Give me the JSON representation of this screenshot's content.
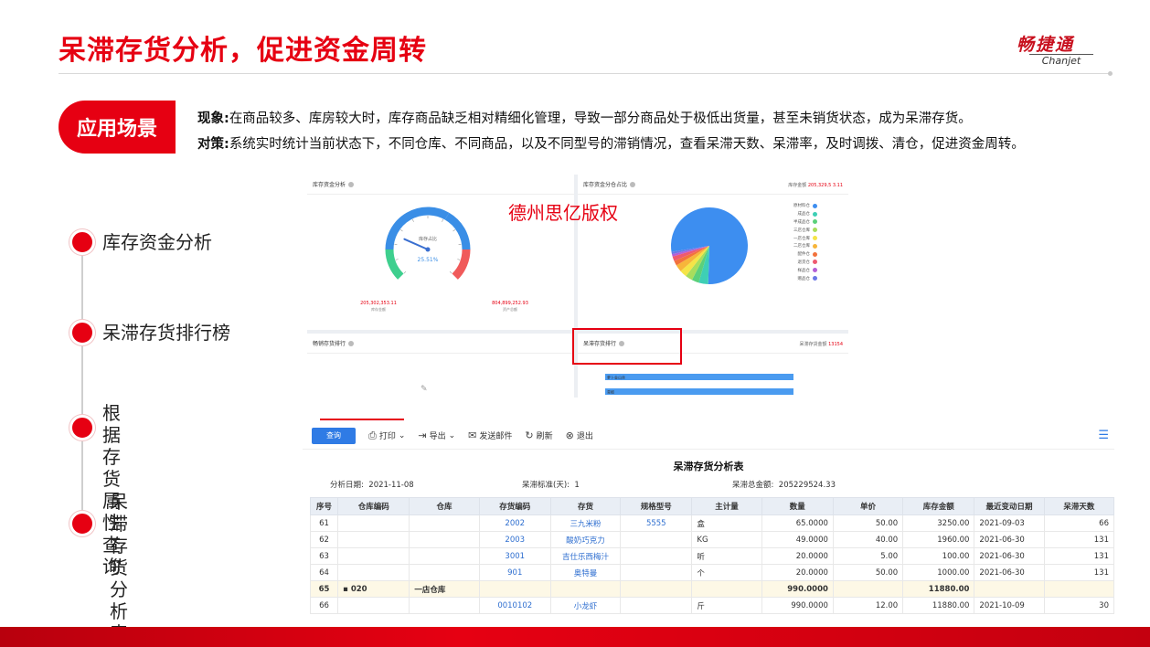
{
  "header": {
    "title": "呆滞存货分析，促进资金周转"
  },
  "logo": {
    "cn": "畅捷通",
    "en": "Chanjet"
  },
  "scene": {
    "tag": "应用场景",
    "phenomenon_label": "现象:",
    "phenomenon_text": "在商品较多、库房较大时，库存商品缺乏相对精细化管理，导致一部分商品处于极低出货量，甚至未销货状态，成为呆滞存货。",
    "strategy_label": "对策:",
    "strategy_text": "系统实时统计当前状态下，不同仓库、不同商品，以及不同型号的滞销情况，查看呆滞天数、呆滞率，及时调拨、清仓，促进资金周转。"
  },
  "timeline": [
    {
      "label": "库存资金分析"
    },
    {
      "label": "呆滞存货排行榜"
    },
    {
      "label": "根据存货属性\n查询"
    },
    {
      "label": "呆滞存货\n分析表"
    }
  ],
  "dashboard": {
    "watermark": "德州思亿版权",
    "panels": {
      "capital": {
        "title": "库存资金分析"
      },
      "share": {
        "title": "库存资金分仓占比",
        "tag_label": "库存金额",
        "tag_value": "205,329,5 3.11"
      },
      "sales": {
        "title": "畅销存货排行"
      },
      "stale": {
        "title": "呆滞存货排行",
        "tag_label": "呆滞存货金额",
        "tag_value": "13154"
      }
    },
    "gauge": {
      "center_label": "库存占比",
      "percent": "25.51%",
      "left_value": "205,302,353.11",
      "left_label": "库存金额",
      "right_value": "804,899,252.93",
      "right_label": "资产总额",
      "fraction": 0.2551
    },
    "pie": {
      "slices": [
        {
          "color": "#3d8ef0",
          "value": 78
        },
        {
          "color": "#3ecfb5",
          "value": 4
        },
        {
          "color": "#5bd07a",
          "value": 3
        },
        {
          "color": "#a8dd5c",
          "value": 3
        },
        {
          "color": "#f5e447",
          "value": 3
        },
        {
          "color": "#f7b53a",
          "value": 3
        },
        {
          "color": "#f2723c",
          "value": 2
        },
        {
          "color": "#ee5a6f",
          "value": 2
        },
        {
          "color": "#b45fd6",
          "value": 1
        },
        {
          "color": "#6a78e6",
          "value": 1
        }
      ],
      "legend": [
        "原材料仓",
        "成品仓",
        "半成品仓",
        "三店仓库",
        "一店仓库",
        "二店仓库",
        "配件仓",
        "退货仓",
        "样品仓",
        "赠品仓"
      ],
      "legend_colors": [
        "#3d8ef0",
        "#3ecfb5",
        "#5bd07a",
        "#a8dd5c",
        "#f5e447",
        "#f7b53a",
        "#f2723c",
        "#ee5a6f",
        "#b45fd6",
        "#6a78e6"
      ]
    },
    "stale_bars": [
      {
        "label": "萝卜金山丝",
        "fraction": 1.0
      },
      {
        "label": "青椒",
        "fraction": 1.0
      }
    ]
  },
  "report": {
    "toolbar": {
      "query": "查询",
      "print": "打印",
      "export": "导出",
      "mail": "发送邮件",
      "refresh": "刷新",
      "exit": "退出"
    },
    "title": "呆滞存货分析表",
    "meta": {
      "date_label": "分析日期:",
      "date_value": "2021-11-08",
      "std_label": "呆滞标准(天):",
      "std_value": "1",
      "total_label": "呆滞总金额:",
      "total_value": "205229524.33"
    },
    "columns": [
      "序号",
      "仓库编码",
      "仓库",
      "存货编码",
      "存货",
      "规格型号",
      "主计量",
      "数量",
      "单价",
      "库存金额",
      "最近变动日期",
      "呆滞天数"
    ],
    "rows": [
      {
        "no": "61",
        "wh_code": "",
        "wh": "",
        "code": "2002",
        "name": "三九米粉",
        "spec": "5555",
        "unit": "盒",
        "qty": "65.0000",
        "price": "50.00",
        "amount": "3250.00",
        "date": "2021-09-03",
        "days": "66",
        "sub": false
      },
      {
        "no": "62",
        "wh_code": "",
        "wh": "",
        "code": "2003",
        "name": "酸奶巧克力",
        "spec": "",
        "unit": "KG",
        "qty": "49.0000",
        "price": "40.00",
        "amount": "1960.00",
        "date": "2021-06-30",
        "days": "131",
        "sub": false
      },
      {
        "no": "63",
        "wh_code": "",
        "wh": "",
        "code": "3001",
        "name": "吉仕乐西梅汁",
        "spec": "",
        "unit": "听",
        "qty": "20.0000",
        "price": "5.00",
        "amount": "100.00",
        "date": "2021-06-30",
        "days": "131",
        "sub": false
      },
      {
        "no": "64",
        "wh_code": "",
        "wh": "",
        "code": "901",
        "name": "奥特曼",
        "spec": "",
        "unit": "个",
        "qty": "20.0000",
        "price": "50.00",
        "amount": "1000.00",
        "date": "2021-06-30",
        "days": "131",
        "sub": false
      },
      {
        "no": "65",
        "wh_code": "020",
        "wh": "一店仓库",
        "code": "",
        "name": "",
        "spec": "",
        "unit": "",
        "qty": "990.0000",
        "price": "",
        "amount": "11880.00",
        "date": "",
        "days": "",
        "sub": true
      },
      {
        "no": "66",
        "wh_code": "",
        "wh": "",
        "code": "0010102",
        "name": "小龙虾",
        "spec": "",
        "unit": "斤",
        "qty": "990.0000",
        "price": "12.00",
        "amount": "11880.00",
        "date": "2021-10-09",
        "days": "30",
        "sub": false
      }
    ]
  }
}
